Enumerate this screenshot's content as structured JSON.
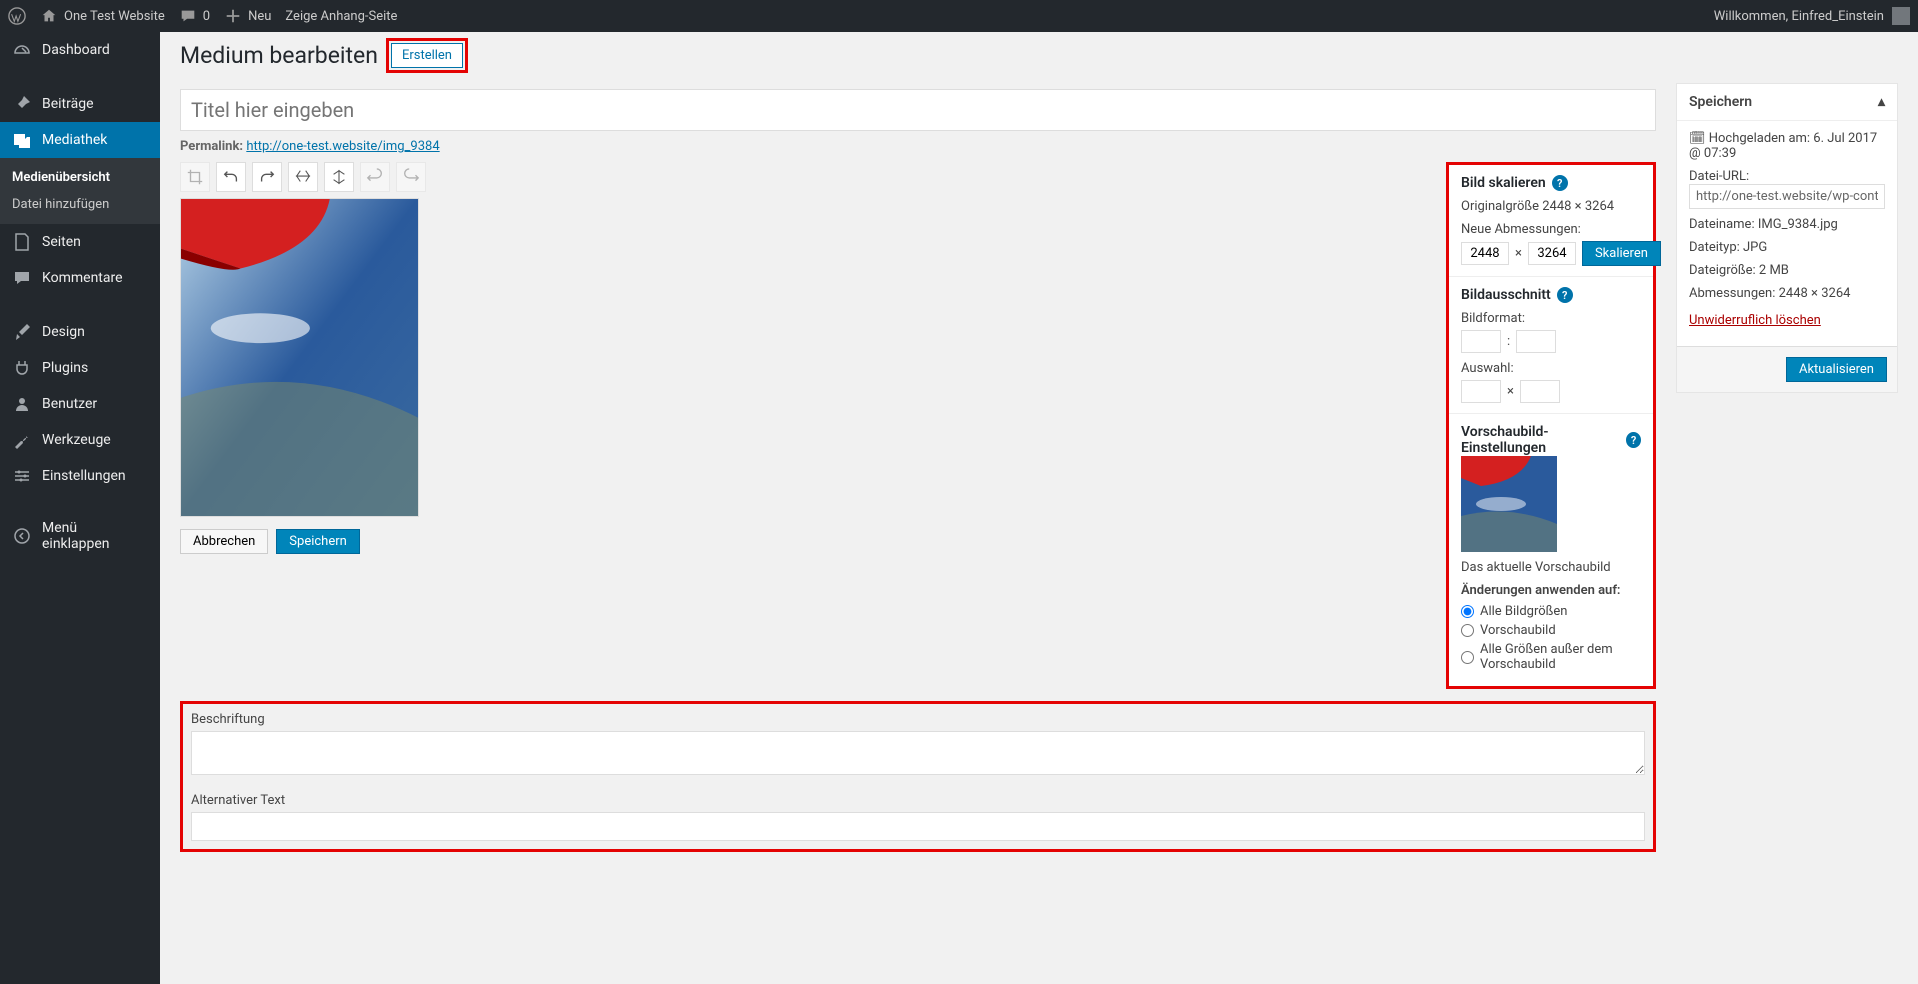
{
  "adminbar": {
    "site_name": "One Test Website",
    "comments": "0",
    "new_label": "Neu",
    "view_attachment": "Zeige Anhang-Seite",
    "welcome": "Willkommen, Einfred_Einstein"
  },
  "sidebar": {
    "dashboard": "Dashboard",
    "posts": "Beiträge",
    "media": "Mediathek",
    "media_sub_overview": "Medienübersicht",
    "media_sub_add": "Datei hinzufügen",
    "pages": "Seiten",
    "comments": "Kommentare",
    "design": "Design",
    "plugins": "Plugins",
    "users": "Benutzer",
    "tools": "Werkzeuge",
    "settings": "Einstellungen",
    "collapse": "Menü einklappen"
  },
  "page": {
    "heading": "Medium bearbeiten",
    "create_btn": "Erstellen",
    "title_placeholder": "Titel hier eingeben",
    "permalink_label": "Permalink:",
    "permalink_url": "http://one-test.website/img_9384",
    "cancel_btn": "Abbrechen",
    "save_btn": "Speichern"
  },
  "scale": {
    "heading": "Bild skalieren",
    "orig_label": "Originalgröße 2448 × 3264",
    "new_dims": "Neue Abmessungen:",
    "w": "2448",
    "h": "3264",
    "times": "×",
    "btn": "Skalieren"
  },
  "crop": {
    "heading": "Bildausschnitt",
    "format_label": "Bildformat:",
    "colon": ":",
    "selection_label": "Auswahl:",
    "times": "×"
  },
  "thumb_settings": {
    "heading": "Vorschaubild-Einstellungen",
    "current": "Das aktuelle Vorschaubild",
    "apply_label": "Änderungen anwenden auf:",
    "opt_all": "Alle Bildgrößen",
    "opt_thumb": "Vorschaubild",
    "opt_except": "Alle Größen außer dem Vorschaubild"
  },
  "save_box": {
    "heading": "Speichern",
    "uploaded_label": "Hochgeladen am: 6. Jul 2017 @ 07:39",
    "file_url_label": "Datei-URL:",
    "file_url": "http://one-test.website/wp-content/uplc",
    "filename_label": "Dateiname:",
    "filename": "IMG_9384.jpg",
    "filetype_label": "Dateityp:",
    "filetype": "JPG",
    "filesize_label": "Dateigröße:",
    "filesize": "2 MB",
    "dims_label": "Abmessungen:",
    "dims": "2448 × 3264",
    "delete": "Unwiderruflich löschen",
    "update_btn": "Aktualisieren"
  },
  "lower": {
    "caption_label": "Beschriftung",
    "alt_label": "Alternativer Text"
  }
}
